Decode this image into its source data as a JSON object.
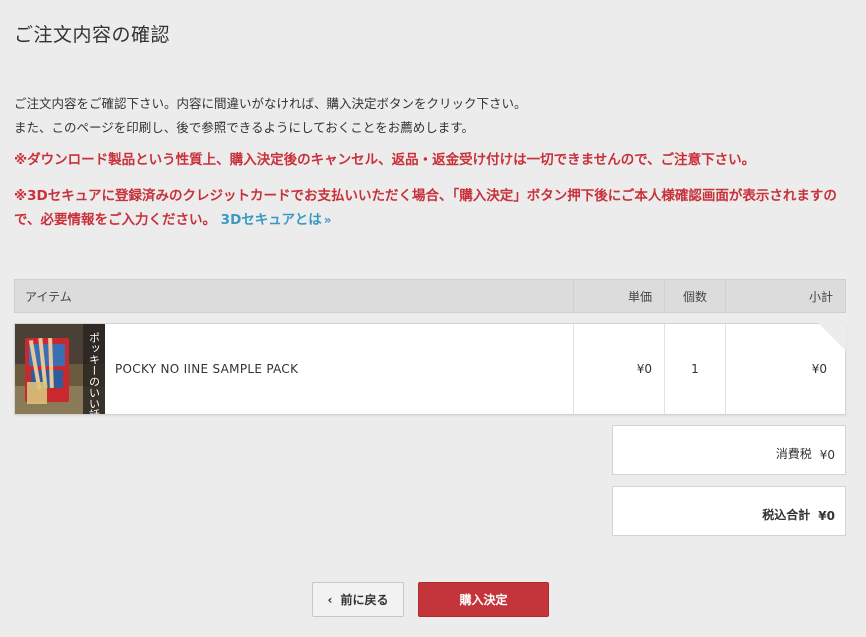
{
  "page": {
    "title": "ご注文内容の確認",
    "intro_line1": "ご注文内容をご確認下さい。内容に間違いがなければ、購入決定ボタンをクリック下さい。",
    "intro_line2": "また、このページを印刷し、後で参照できるようにしておくことをお薦めします。",
    "warning1": "※ダウンロード製品という性質上、購入決定後のキャンセル、返品・返金受け付けは一切できませんので、ご注意下さい。",
    "warning2": "※3Dセキュアに登録済みのクレジットカードでお支払いいただく場合、「購入決定」ボタン押下後にご本人様確認画面が表示されますので、必要情報をご入力ください。",
    "secure_link": "3Dセキュアとは"
  },
  "table": {
    "headers": {
      "item": "アイテム",
      "price": "単価",
      "qty": "個数",
      "subtotal": "小計"
    },
    "rows": [
      {
        "image_text": "ポッキーのいい話",
        "name": "POCKY NO IINE SAMPLE PACK",
        "price": "¥0",
        "qty": "1",
        "subtotal": "¥0"
      }
    ]
  },
  "summary": {
    "tax_label": "消費税",
    "tax_value": "¥0",
    "total_label": "税込合計",
    "total_value": "¥0"
  },
  "buttons": {
    "back_label": "前に戻る",
    "buy_label": "購入決定"
  },
  "colors": {
    "accent_red": "#c4343b",
    "warning_red": "#c8313a",
    "link_blue": "#3a98c4",
    "background": "#ececec"
  },
  "icons": {
    "back": "chevron-left-icon",
    "link": "double-chevron-right-icon"
  }
}
